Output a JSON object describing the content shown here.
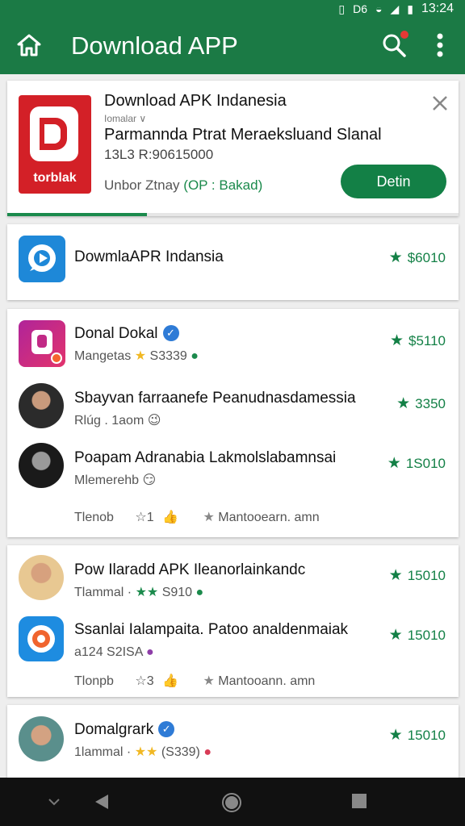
{
  "status": {
    "time": "13:24",
    "carrier": "D6"
  },
  "appbar": {
    "title": "Download APP"
  },
  "ad": {
    "icon_brand": "torblak",
    "title": "Download APK Indanesia",
    "subtitle": "Iomalar ∨",
    "description": "Parmannda Ptrat Meraeksluand Slanal",
    "meta": "13L3 R:90615000",
    "rating_label": "Unbor Ztnay",
    "rating_value": "(OP : Bakad)",
    "install_label": "Detin",
    "progress": 0.31
  },
  "single": {
    "name": "DowmlaAPR Indansia",
    "price": "$6010"
  },
  "group1": {
    "rows": [
      {
        "name": "Donal Dokal",
        "sub": "Mangetas",
        "sub2": "S3339",
        "price": "$5110"
      },
      {
        "name": "Sbayvan farraanefe Peanudnasdamessia",
        "sub": "Rlúg . 1aom",
        "price": "3350"
      },
      {
        "name": "Poapam Adranabia Lakmolslabamnsai",
        "sub": "Mlemerehb",
        "price": "1S010"
      }
    ],
    "footer_left": "Tlenob",
    "footer_like": "1",
    "footer_right": "Mantooearn. amn"
  },
  "group2": {
    "rows": [
      {
        "name": "Pow Ilaradd APK Ileanorlainkandc",
        "sub": "Tlammal ·",
        "sub2": "S910",
        "price": "15010"
      },
      {
        "name": "Ssanlai Ialampaita. Patoo analdenmaiak",
        "sub": "a124 S2ISA",
        "price": "15010"
      }
    ],
    "footer_left": "Tlonpb",
    "footer_like": "3",
    "footer_right": "Mantooann. amn"
  },
  "group3": {
    "rows": [
      {
        "name": "Domalgrark",
        "sub": "1lammal ·",
        "sub2": "(S339)",
        "price": "15010"
      }
    ]
  },
  "colors": {
    "primary": "#1b7a45",
    "accent": "#138046",
    "ad_red": "#d32027"
  }
}
